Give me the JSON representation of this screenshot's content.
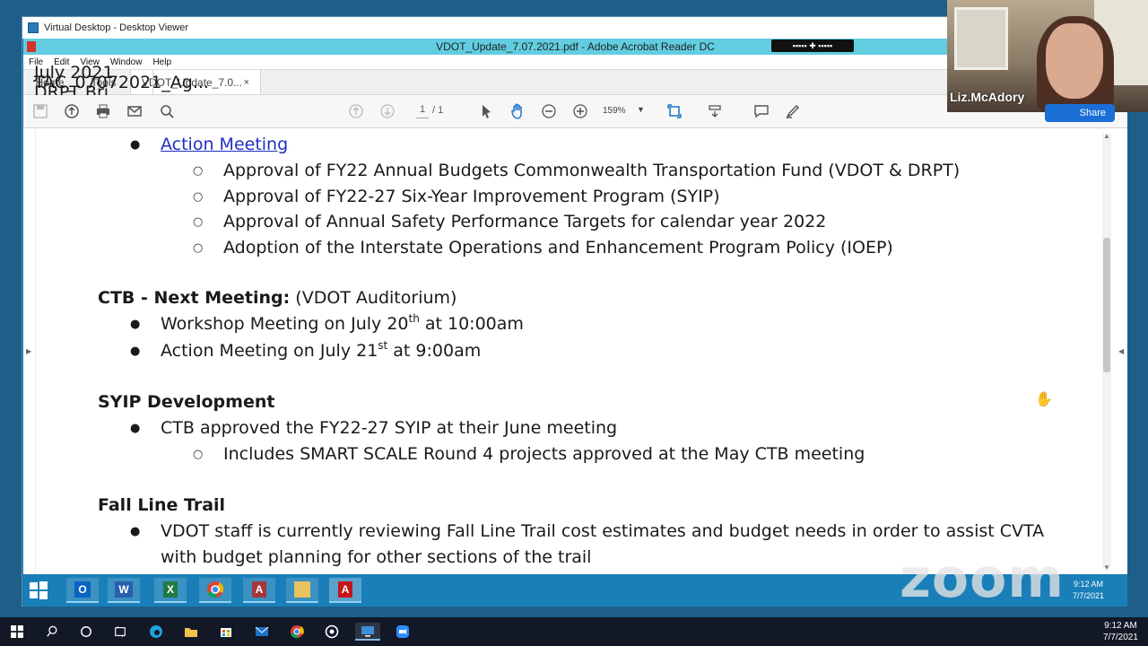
{
  "host_window": {
    "title": "Virtual Desktop - Desktop Viewer"
  },
  "acrobat": {
    "title": "VDOT_Update_7.07.2021.pdf - Adobe Acrobat Reader DC",
    "menu": [
      "File",
      "Edit",
      "View",
      "Window",
      "Help"
    ],
    "tabs": [
      {
        "label": "Home"
      },
      {
        "label": "Tools"
      },
      {
        "label": "TAC_07072021_Ag..."
      },
      {
        "label": "July 2021 DRPT Bri..."
      },
      {
        "label": "VDOT_Update_7.0...",
        "close": "×"
      }
    ],
    "toolbar": {
      "page_current": "1",
      "page_total": "/ 1",
      "zoom": "159%"
    }
  },
  "document": {
    "action_meeting": {
      "heading": "Action Meeting",
      "items": [
        "Approval of FY22 Annual Budgets Commonwealth Transportation Fund (VDOT & DRPT)",
        "Approval of FY22-27 Six-Year Improvement Program (SYIP)",
        "Approval of Annual Safety Performance Targets for calendar year 2022",
        "Adoption of the Interstate Operations and Enhancement Program Policy (IOEP)"
      ]
    },
    "ctb_next": {
      "heading": "CTB - Next Meeting:",
      "heading_suffix": " (VDOT Auditorium)",
      "item1_pre": "Workshop Meeting on July 20",
      "item1_sup": "th",
      "item1_post": " at 10:00am",
      "item2_pre": "Action Meeting on July 21",
      "item2_sup": "st",
      "item2_post": " at 9:00am"
    },
    "syip": {
      "heading": "SYIP Development",
      "item": "CTB approved the FY22-27 SYIP at their June meeting",
      "subitem": "Includes SMART SCALE Round 4 projects approved at the May CTB meeting"
    },
    "fall_line": {
      "heading": "Fall Line Trail",
      "item_line1": "VDOT staff is currently reviewing Fall Line Trail cost estimates and budget needs in order to assist CVTA",
      "item_line2": "with budget planning for other sections of the trail"
    }
  },
  "inner_taskbar": {
    "time": "9:12 AM",
    "date": "7/7/2021"
  },
  "zoom": {
    "watermark": "zoom",
    "participant_name": "Liz.McAdory",
    "share_label": "Share"
  },
  "host_taskbar": {
    "time": "9:12 AM",
    "date": "7/7/2021"
  }
}
